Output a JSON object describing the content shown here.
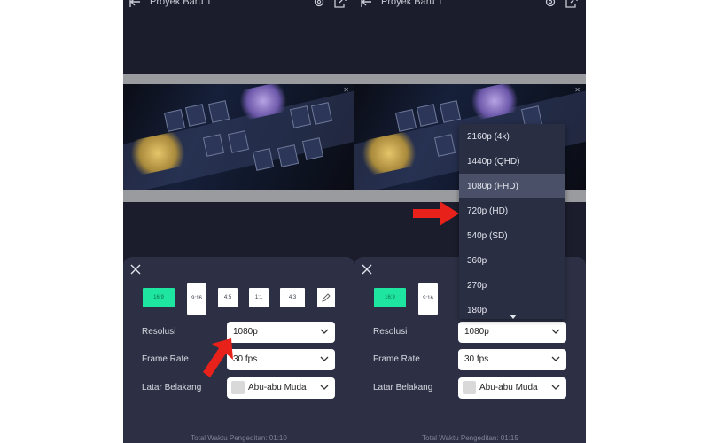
{
  "project_title": "Proyek Baru 1",
  "aspect_ratios": [
    "16:9",
    "9:16",
    "4:5",
    "1:1",
    "4:3"
  ],
  "labels": {
    "resolution": "Resolusi",
    "frame_rate": "Frame Rate",
    "background": "Latar Belakang"
  },
  "left_panel": {
    "resolution": "1080p",
    "frame_rate": "30 fps",
    "background": "Abu-abu Muda",
    "total_time": "Total Waktu Pengeditan: 01:10"
  },
  "right_panel": {
    "resolution": "1080p",
    "frame_rate": "30 fps",
    "background": "Abu-abu Muda",
    "total_time": "Total Waktu Pengeditan: 01:15",
    "resolution_options": [
      "2160p (4k)",
      "1440p (QHD)",
      "1080p (FHD)",
      "720p (HD)",
      "540p (SD)",
      "360p",
      "270p",
      "180p"
    ],
    "highlighted_option": "1080p (FHD)"
  },
  "colors": {
    "accent": "#1ee6a0",
    "arrow": "#e8211b",
    "sheet": "#2d3045",
    "background": "#1b1d2c"
  },
  "icons": [
    "back-arrow-icon",
    "gear-icon",
    "share-icon",
    "close-icon",
    "pencil-icon",
    "chevron-down-icon"
  ]
}
